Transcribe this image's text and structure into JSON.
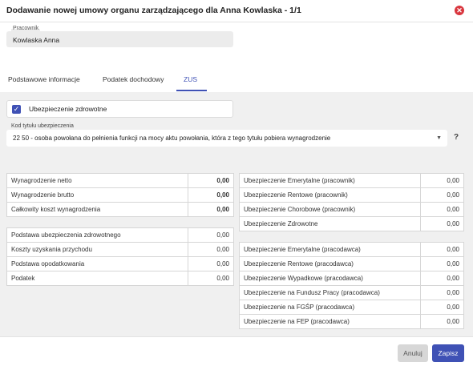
{
  "dialog": {
    "title": "Dodawanie nowej umowy organu zarządzającego dla Anna Kowlaska - 1/1",
    "close_icon": "close-icon"
  },
  "employee": {
    "label": "Pracownik",
    "value": "Kowlaska Anna"
  },
  "tabs": [
    {
      "label": "Podstawowe informacje",
      "active": false
    },
    {
      "label": "Podatek dochodowy",
      "active": false
    },
    {
      "label": "ZUS",
      "active": true
    }
  ],
  "health_insurance": {
    "label": "Ubezpieczenie zdrowotne",
    "checked": true
  },
  "insurance_code": {
    "label": "Kod tytułu ubezpieczenia",
    "value": "22 50 - osoba powołana do pełnienia funkcji na mocy aktu powołania, która z tego tytułu pobiera wynagrodzenie",
    "help": "?"
  },
  "left_top": [
    {
      "label": "Wynagrodzenie netto",
      "value": "0,00"
    },
    {
      "label": "Wynagrodzenie brutto",
      "value": "0,00"
    },
    {
      "label": "Całkowity koszt wynagrodzenia",
      "value": "0,00"
    }
  ],
  "left_bottom": [
    {
      "label": "Podstawa ubezpieczenia zdrowotnego",
      "value": "0,00"
    },
    {
      "label": "Koszty uzyskania przychodu",
      "value": "0,00"
    },
    {
      "label": "Podstawa opodatkowania",
      "value": "0,00"
    },
    {
      "label": "Podatek",
      "value": "0,00"
    }
  ],
  "right_top": [
    {
      "label": "Ubezpieczenie Emerytalne (pracownik)",
      "value": "0,00"
    },
    {
      "label": "Ubezpieczenie Rentowe (pracownik)",
      "value": "0,00"
    },
    {
      "label": "Ubezpieczenie Chorobowe (pracownik)",
      "value": "0,00"
    },
    {
      "label": "Ubezpieczenie Zdrowotne",
      "value": "0,00"
    }
  ],
  "right_bottom": [
    {
      "label": "Ubezpieczenie Emerytalne (pracodawca)",
      "value": "0,00"
    },
    {
      "label": "Ubezpieczenie Rentowe (pracodawca)",
      "value": "0,00"
    },
    {
      "label": "Ubezpieczenie Wypadkowe (pracodawca)",
      "value": "0,00"
    },
    {
      "label": "Ubezpieczenie na Fundusz Pracy (pracodawca)",
      "value": "0,00"
    },
    {
      "label": "Ubezpieczenie na FGŚP (pracodawca)",
      "value": "0,00"
    },
    {
      "label": "Ubezpieczenie na FEP (pracodawca)",
      "value": "0,00"
    }
  ],
  "footer": {
    "cancel_label": "Anuluj",
    "save_label": "Zapisz"
  },
  "colors": {
    "accent": "#3f51b5",
    "close": "#d9363e"
  }
}
